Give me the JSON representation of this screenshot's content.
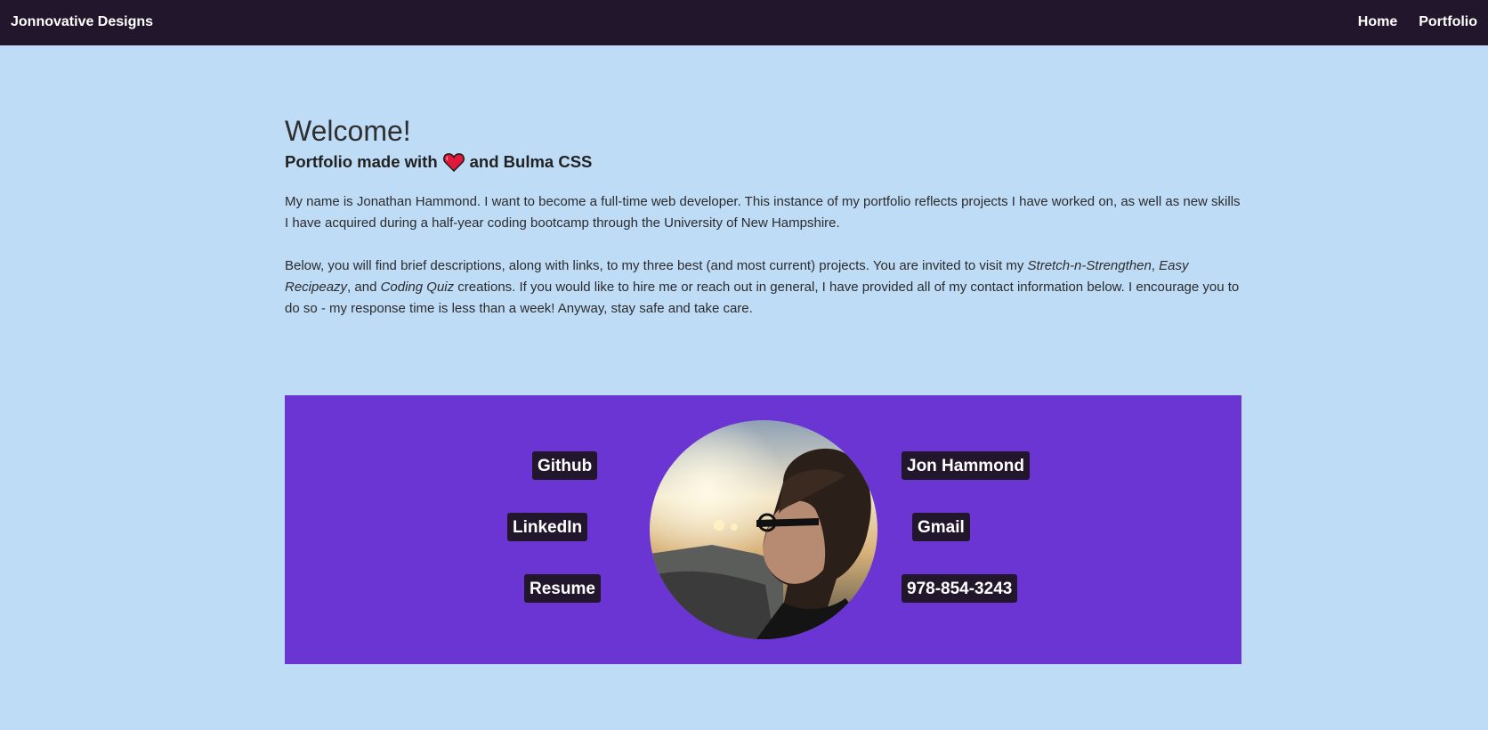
{
  "nav": {
    "brand": "Jonnovative Designs",
    "links": [
      {
        "label": "Home"
      },
      {
        "label": "Portfolio"
      }
    ]
  },
  "hero": {
    "title": "Welcome!",
    "subtitle_before": "Portfolio made with",
    "subtitle_icon": "heart-icon",
    "subtitle_after": "and Bulma CSS",
    "intro": "My name is Jonathan Hammond. I want to become a full-time web developer. This instance of my portfolio reflects projects I have worked on, as well as new skills I have acquired during a half-year coding bootcamp through the University of New Hampshire.",
    "projects_1": "Below, you will find brief descriptions, along with links, to my three best (and most current) projects. You are invited to visit my ",
    "project_a": "Stretch-n-Strengthen",
    "projects_2": ", ",
    "project_b": "Easy Recipeazy",
    "projects_3": ", and ",
    "project_c": "Coding Quiz",
    "projects_4": " creations. If you would like to hire me or reach out in general, I have provided all of my contact information below. I encourage you to do so - my response time is less than a week! Anyway, stay safe and take care."
  },
  "contact": {
    "left": [
      "Github",
      "LinkedIn",
      "Resume"
    ],
    "right": [
      "Jon Hammond",
      "Gmail",
      "978-854-3243"
    ],
    "avatar_icon": "profile-photo"
  },
  "colors": {
    "navbar": "#21162b",
    "page_bg": "#bfdcf7",
    "panel": "#6a35d2",
    "tag_bg": "#21162b",
    "heart": "#e0193a"
  }
}
